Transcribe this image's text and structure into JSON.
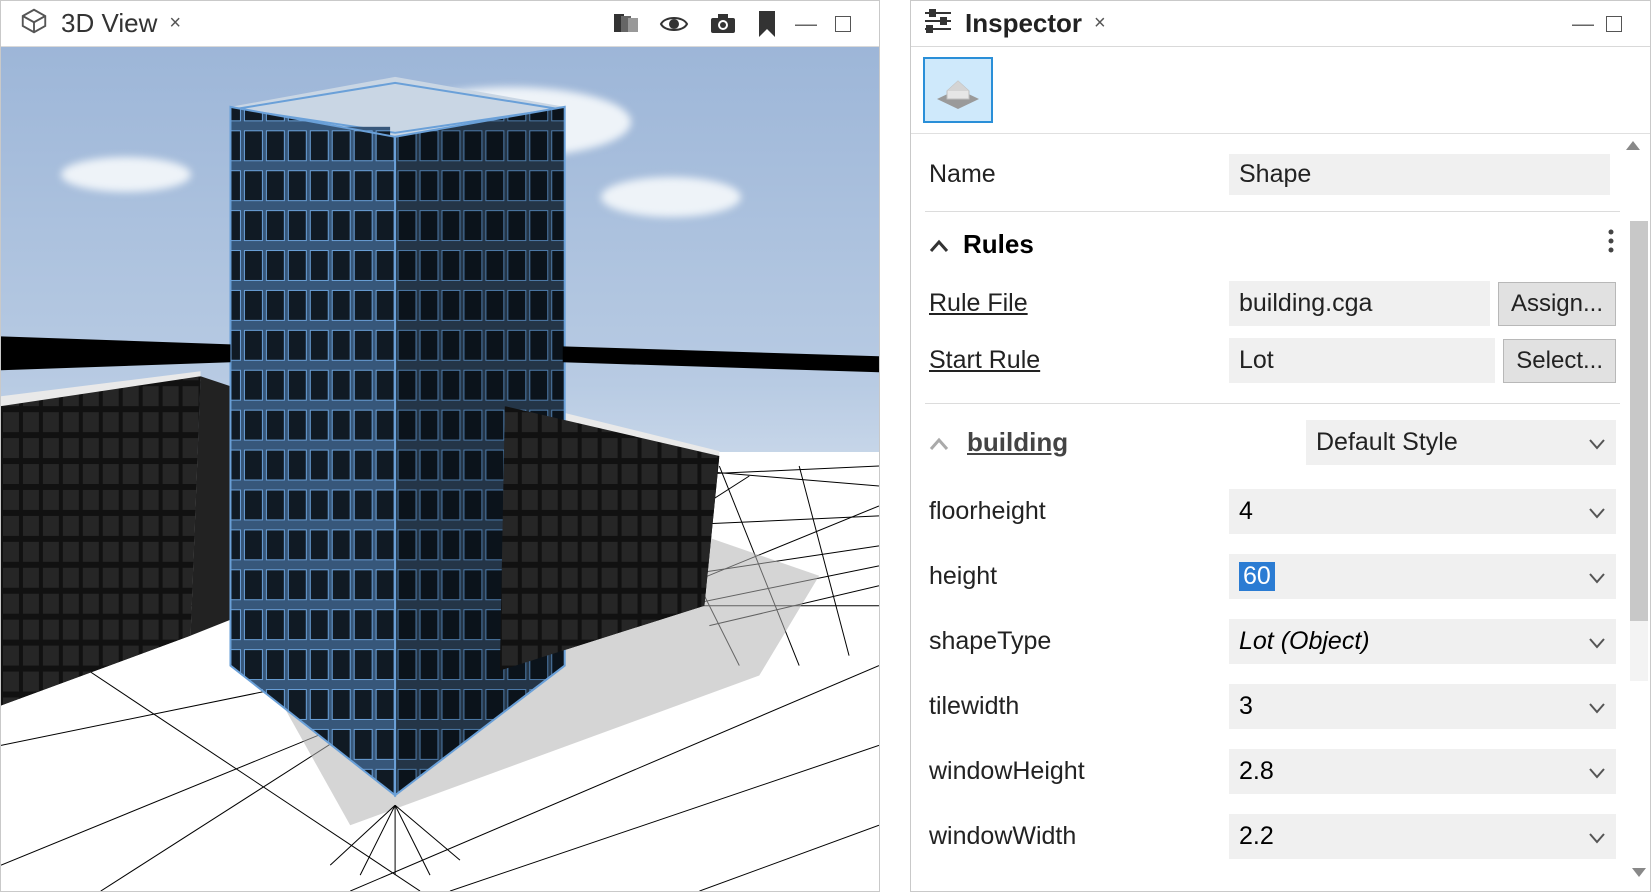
{
  "view3d": {
    "title": "3D View",
    "close_icon_label": "×",
    "toolbar_icons": [
      "layers-icon",
      "visibility-icon",
      "camera-icon",
      "bookmark-icon",
      "minimize",
      "maximize"
    ]
  },
  "inspector": {
    "title": "Inspector",
    "close_icon_label": "×",
    "tab_icon": "shape-object-tab",
    "name_label": "Name",
    "name_value": "Shape",
    "rules_section": {
      "title": "Rules",
      "rule_file_label": "Rule File",
      "rule_file_value": "building.cga",
      "assign_btn": "Assign...",
      "start_rule_label": "Start Rule",
      "start_rule_value": "Lot",
      "select_btn": "Select..."
    },
    "building_section": {
      "title": "building",
      "style_label": "Default Style",
      "attrs": [
        {
          "name": "floorheight",
          "value": "4",
          "selected": false,
          "italic": false
        },
        {
          "name": "height",
          "value": "60",
          "selected": true,
          "italic": false
        },
        {
          "name": "shapeType",
          "value": "Lot (Object)",
          "selected": false,
          "italic": true
        },
        {
          "name": "tilewidth",
          "value": "3",
          "selected": false,
          "italic": false
        },
        {
          "name": "windowHeight",
          "value": "2.8",
          "selected": false,
          "italic": false
        },
        {
          "name": "windowWidth",
          "value": "2.2",
          "selected": false,
          "italic": false
        }
      ]
    }
  }
}
